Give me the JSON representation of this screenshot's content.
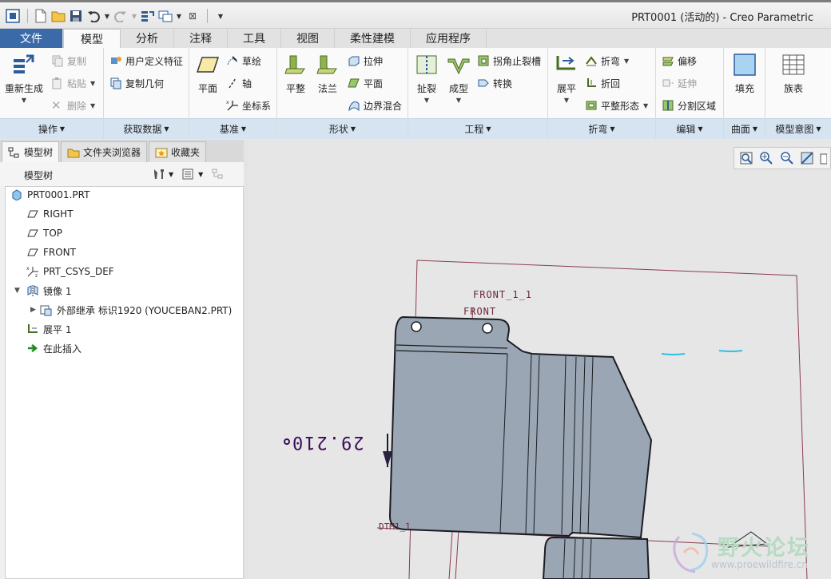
{
  "window": {
    "title": "PRT0001 (活动的) - Creo Parametric"
  },
  "quick_access": {
    "icons": [
      "app-icon",
      "new-icon",
      "open-icon",
      "save-icon",
      "undo-icon",
      "redo-icon",
      "regenerate-icon",
      "window-icon",
      "close-icon",
      "customize-icon"
    ]
  },
  "tabs": [
    {
      "label": "文件"
    },
    {
      "label": "模型"
    },
    {
      "label": "分析"
    },
    {
      "label": "注释"
    },
    {
      "label": "工具"
    },
    {
      "label": "视图"
    },
    {
      "label": "柔性建模"
    },
    {
      "label": "应用程序"
    }
  ],
  "ribbon": {
    "operations": {
      "footer": "操作",
      "regenerate": "重新生成",
      "copy": "复制",
      "paste": "粘贴",
      "delete": "删除"
    },
    "get_data": {
      "footer": "获取数据",
      "udf": "用户定义特征",
      "copy_geometry": "复制几何"
    },
    "datum": {
      "footer": "基准",
      "plane": "平面",
      "sketch": "草绘",
      "axis": "轴",
      "csys": "坐标系"
    },
    "shapes": {
      "footer": "形状",
      "flat": "平整",
      "flange": "法兰",
      "extrude": "拉伸",
      "plane": "平面",
      "blend": "边界混合"
    },
    "engineering": {
      "footer": "工程",
      "rip": "扯裂",
      "form": "成型",
      "corner_relief": "拐角止裂槽",
      "convert": "转换"
    },
    "bend": {
      "footer": "折弯",
      "unbend": "展平",
      "bend": "折弯",
      "bend_back": "折回",
      "flat_state": "平整形态"
    },
    "edit": {
      "footer": "编辑",
      "offset": "偏移",
      "extend": "延伸",
      "split_area": "分割区域"
    },
    "surface": {
      "footer": "曲面",
      "fill": "填充"
    },
    "model_intent": {
      "footer": "模型意图",
      "family_table": "族表"
    }
  },
  "left_panel": {
    "tabs": [
      {
        "label": "模型树"
      },
      {
        "label": "文件夹浏览器"
      },
      {
        "label": "收藏夹"
      }
    ],
    "header": "模型树",
    "tree": [
      {
        "label": "PRT0001.PRT",
        "icon": "part-icon"
      },
      {
        "label": "RIGHT",
        "icon": "datum-plane-icon"
      },
      {
        "label": "TOP",
        "icon": "datum-plane-icon"
      },
      {
        "label": "FRONT",
        "icon": "datum-plane-icon"
      },
      {
        "label": "PRT_CSYS_DEF",
        "icon": "csys-icon"
      },
      {
        "label": "镜像 1",
        "icon": "mirror-icon"
      },
      {
        "label": "外部继承 标识1920 (YOUCEBAN2.PRT)",
        "icon": "external-inheritance-icon"
      },
      {
        "label": "展平 1",
        "icon": "unbend-icon"
      },
      {
        "label": "在此插入",
        "icon": "insert-here-icon"
      }
    ]
  },
  "canvas": {
    "labels": {
      "front_1_1": "FRONT_1_1",
      "front": "FRONT",
      "dimension": "29.210",
      "dtm": "DTM1_1"
    },
    "view_tools": [
      "refit-icon",
      "zoom-in-icon",
      "zoom-out-icon",
      "repaint-icon",
      "view-manager-icon"
    ]
  },
  "watermark": {
    "title": "野火论坛",
    "url": "www.proewildfire.cn"
  },
  "colors": {
    "part_fill": "#9aa6b3",
    "part_edge": "#1a1d22",
    "datum": "#8a3d4d",
    "accent_tab": "#3b6aa8",
    "ribbon_footer": "#d6e4f2"
  }
}
